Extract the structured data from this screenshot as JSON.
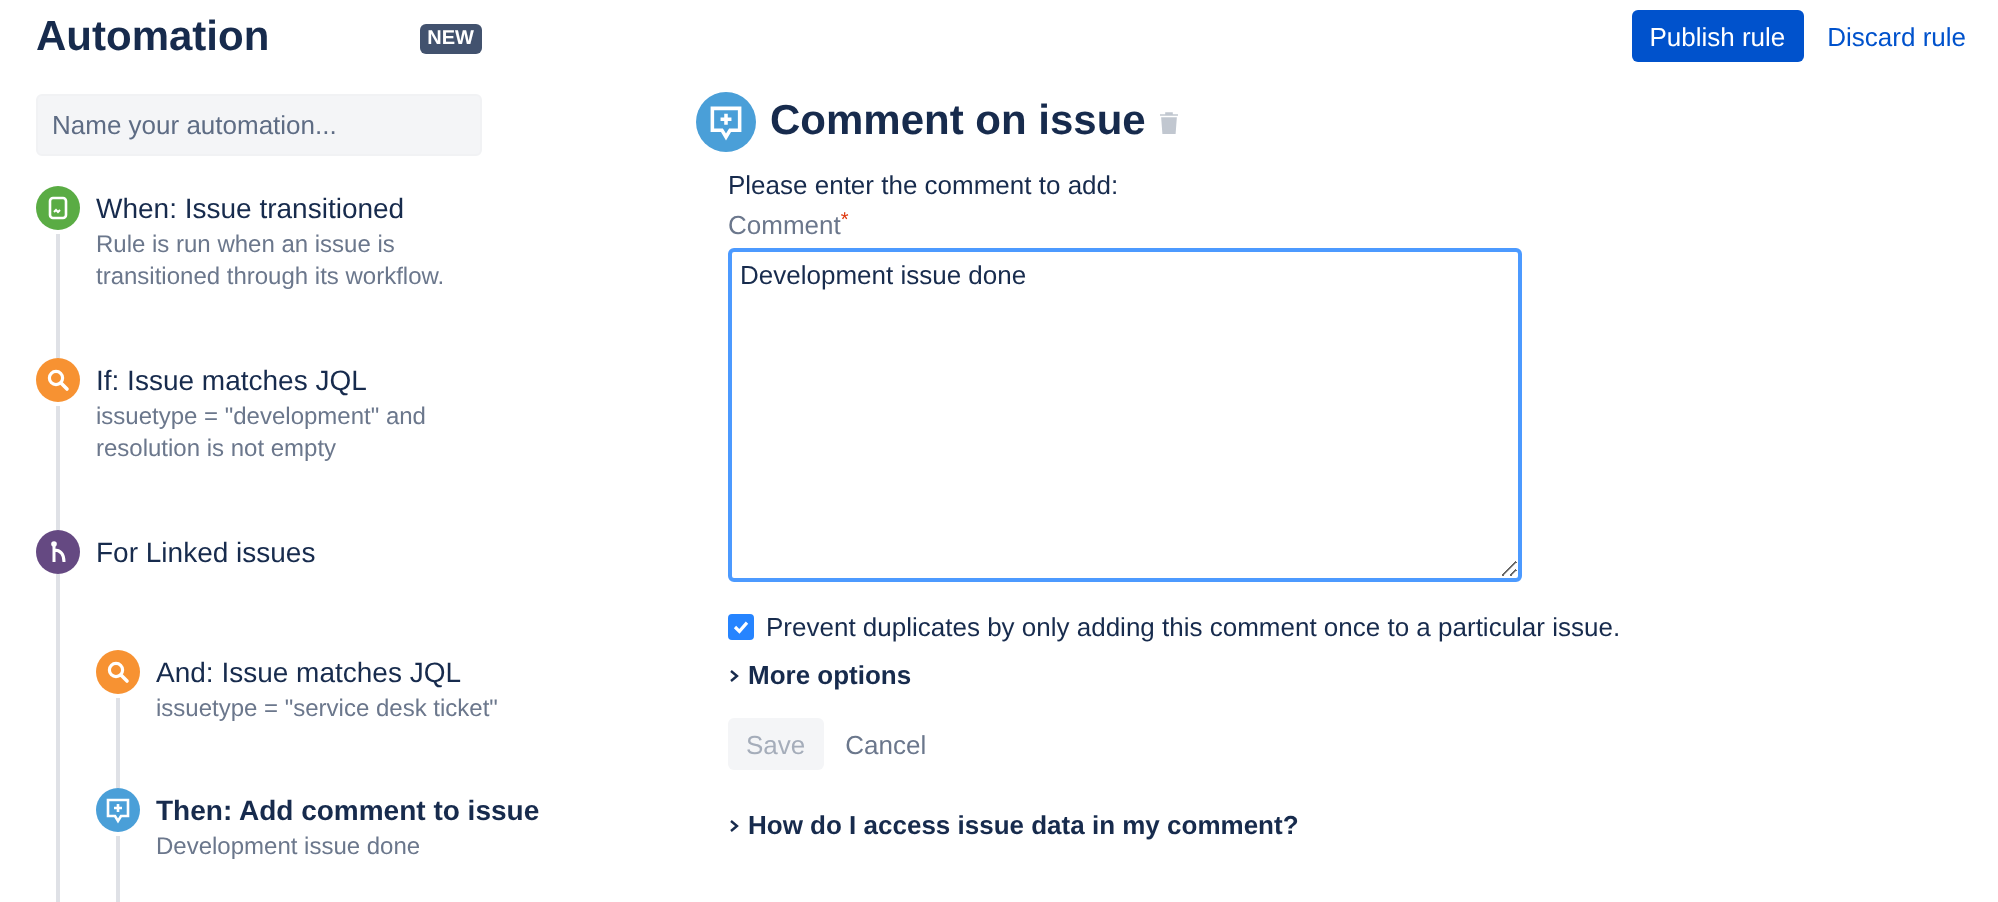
{
  "sidebar": {
    "title": "Automation",
    "badge": "NEW",
    "name_field": {
      "placeholder": "Name your automation..."
    },
    "steps": [
      {
        "kind": "trigger",
        "title": "When: Issue transitioned",
        "description": "Rule is run when an issue is transitioned through its workflow.",
        "selected": false
      },
      {
        "kind": "condition",
        "title": "If: Issue matches JQL",
        "description": "issuetype = \"development\" and resolution is not empty",
        "selected": false
      },
      {
        "kind": "branch",
        "title": "For Linked issues",
        "selected": false,
        "children": [
          {
            "kind": "condition",
            "title": "And: Issue matches JQL",
            "description": "issuetype = \"service desk ticket\"",
            "selected": false
          },
          {
            "kind": "action",
            "title": "Then: Add comment to issue",
            "description": "Development issue done",
            "selected": true
          }
        ]
      }
    ]
  },
  "header": {
    "buttons": [
      {
        "kind": "primary",
        "label": "Publish rule"
      },
      {
        "kind": "link",
        "label": "Discard rule"
      }
    ]
  },
  "editor": {
    "title": "Comment on issue",
    "prompt": "Please enter the comment to add:",
    "field_label": "Comment",
    "required_mark": "*",
    "comment": "Development issue done",
    "prevent_duplicates": {
      "label": "Prevent duplicates by only adding this comment once to a particular issue.",
      "checked": true
    },
    "more_options": {
      "label": "More options",
      "expanded": false
    },
    "buttons": [
      {
        "kind": "save",
        "label": "Save",
        "disabled": true
      },
      {
        "kind": "cancel",
        "label": "Cancel",
        "disabled": false
      }
    ],
    "help": {
      "label": "How do I access issue data in my comment?",
      "expanded": false
    }
  }
}
